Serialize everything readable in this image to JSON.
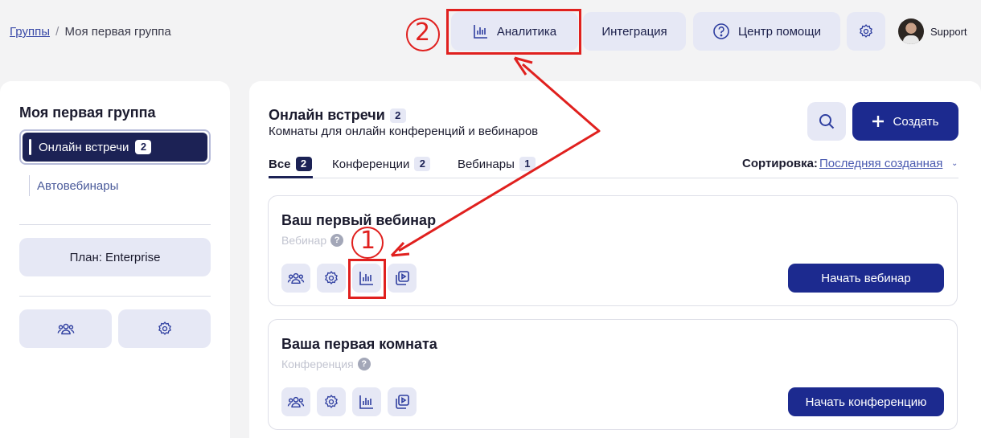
{
  "breadcrumb": {
    "parent": "Группы",
    "separator": "/",
    "current": "Моя первая группа"
  },
  "header": {
    "analytics_label": "Аналитика",
    "integration_label": "Интеграция",
    "help_label": "Центр помощи",
    "user_name": "Support"
  },
  "sidebar": {
    "group_title": "Моя первая группа",
    "items": [
      {
        "label": "Онлайн встречи",
        "count": "2"
      },
      {
        "label": "Автовебинары"
      }
    ],
    "plan_label": "План: Enterprise"
  },
  "main": {
    "title": "Онлайн встречи",
    "title_count": "2",
    "subtitle": "Комнаты для онлайн конференций и вебинаров",
    "create_label": "Создать",
    "tabs": [
      {
        "label": "Все",
        "count": "2"
      },
      {
        "label": "Конференции",
        "count": "2"
      },
      {
        "label": "Вебинары",
        "count": "1"
      }
    ],
    "sort_label": "Сортировка:",
    "sort_value": "Последняя созданная",
    "cards": [
      {
        "title": "Ваш первый вебинар",
        "type": "Вебинар",
        "action": "Начать вебинар"
      },
      {
        "title": "Ваша первая комната",
        "type": "Конференция",
        "action": "Начать конференцию"
      }
    ]
  },
  "annotations": {
    "marker_1": "1",
    "marker_2": "2",
    "color": "#e0201e"
  },
  "colors": {
    "primary": "#1c2a8f",
    "nav_active": "#1c2255",
    "soft_button": "#e6e8f5",
    "page_bg": "#f3f3f4"
  }
}
